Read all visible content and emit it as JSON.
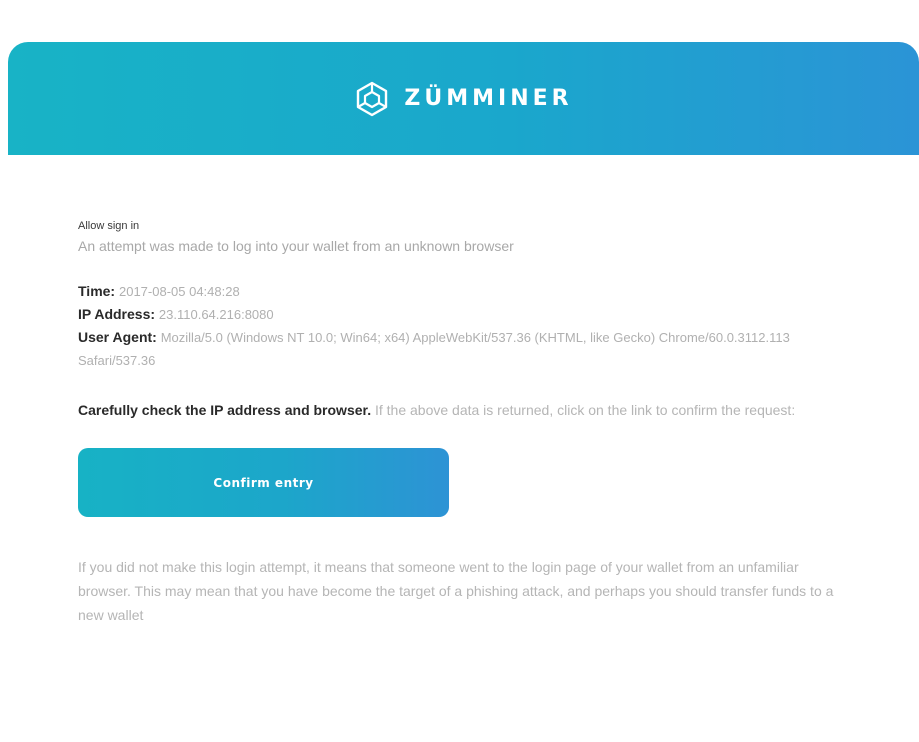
{
  "header": {
    "brand_name": "ZÜMMINER",
    "logo_icon": "hexagon-cube-logo-icon",
    "gradient": [
      "#18b3c6",
      "#2b94d6"
    ]
  },
  "message": {
    "heading": "Allow sign in",
    "intro": "An attempt was made to log into your wallet from an unknown browser"
  },
  "details": {
    "time_label": "Time:",
    "time_value": "2017-08-05 04:48:28",
    "ip_label": "IP Address:",
    "ip_value": "23.110.64.216:8080",
    "ua_label": "User Agent:",
    "ua_value": "Mozilla/5.0 (Windows NT 10.0; Win64; x64) AppleWebKit/537.36 (KHTML, like Gecko) Chrome/60.0.3112.113 Safari/537.36"
  },
  "warning": {
    "strong": "Carefully check the IP address and browser.",
    "rest": "If the above data is returned, click on the link to confirm the request:"
  },
  "button": {
    "label": "Confirm entry"
  },
  "footer": {
    "text": "If you did not make this login attempt, it means that someone went to the login page of your wallet from an unfamiliar browser. This may mean that you have become the target of a phishing attack, and perhaps you should transfer funds to a new wallet"
  }
}
